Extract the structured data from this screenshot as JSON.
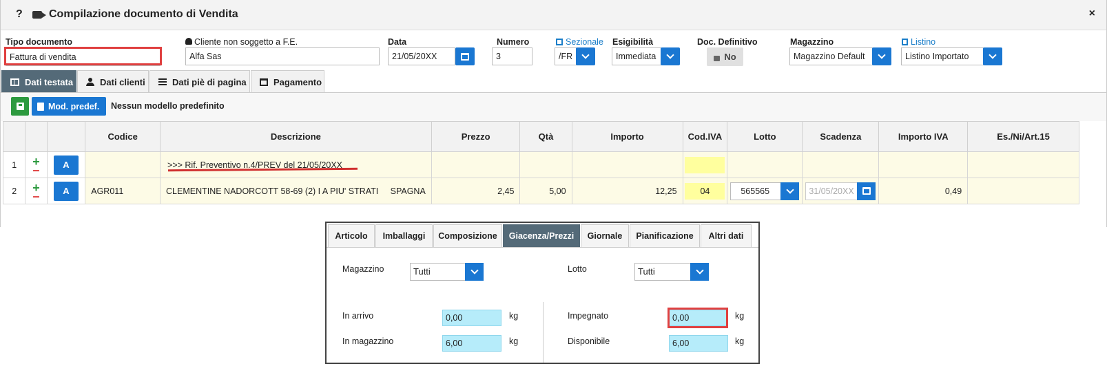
{
  "window": {
    "title": "Compilazione documento di Vendita",
    "help": "?",
    "close": "×"
  },
  "header": {
    "tipo_label": "Tipo documento",
    "tipo_value": "Fattura di vendita",
    "cliente_label": "Cliente non soggetto a F.E.",
    "cliente_value": "Alfa Sas",
    "data_label": "Data",
    "data_value": "21/05/20XX",
    "numero_label": "Numero",
    "numero_value": "3",
    "sezionale_label": "Sezionale",
    "sezionale_value": "/FR",
    "esigibilita_label": "Esigibilità",
    "esigibilita_value": "Immediata",
    "definitivo_label": "Doc. Definitivo",
    "definitivo_value": "No",
    "magazzino_label": "Magazzino",
    "magazzino_value": "Magazzino Default",
    "listino_label": "Listino",
    "listino_value": "Listino Importato"
  },
  "tabs": [
    {
      "label": "Dati testata",
      "icon": "grid-icon"
    },
    {
      "label": "Dati clienti",
      "icon": "user-icon"
    },
    {
      "label": "Dati piè di pagina",
      "icon": "list-icon"
    },
    {
      "label": "Pagamento",
      "icon": "calendar-icon"
    }
  ],
  "toolbar": {
    "mod_label": "Mod. predef.",
    "no_model": "Nessun modello predefinito"
  },
  "table": {
    "headers": [
      "Codice",
      "Descrizione",
      "Prezzo",
      "Qtà",
      "Importo",
      "Cod.IVA",
      "Lotto",
      "Scadenza",
      "Importo IVA",
      "Es./Ni/Art.15"
    ],
    "rows": [
      {
        "idx": "1",
        "btn": "A",
        "codice": "",
        "descrizione": ">>> Rif. Preventivo n.4/PREV del 21/05/20XX",
        "prezzo": "",
        "qta": "",
        "importo": "",
        "iva": "",
        "lotto": "",
        "scadenza": "",
        "importo_iva": "",
        "es": ""
      },
      {
        "idx": "2",
        "btn": "A",
        "codice": "AGR011",
        "descrizione": "CLEMENTINE NADORCOTT 58-69 (2) I A PIU' STRATI     SPAGNA",
        "prezzo": "2,45",
        "qta": "5,00",
        "importo": "12,25",
        "iva": "04",
        "lotto": "565565",
        "scadenza": "31/05/20XX",
        "importo_iva": "0,49",
        "es": ""
      }
    ]
  },
  "panel": {
    "tabs": [
      "Articolo",
      "Imballaggi",
      "Composizione",
      "Giacenza/Prezzi",
      "Giornale",
      "Pianificazione",
      "Altri dati"
    ],
    "magazzino_label": "Magazzino",
    "magazzino_value": "Tutti",
    "lotto_label": "Lotto",
    "lotto_value": "Tutti",
    "in_arrivo_label": "In arrivo",
    "in_arrivo_value": "0,00",
    "in_magazzino_label": "In magazzino",
    "in_magazzino_value": "6,00",
    "impegnato_label": "Impegnato",
    "impegnato_value": "0,00",
    "disponibile_label": "Disponibile",
    "disponibile_value": "6,00",
    "unit": "kg"
  }
}
